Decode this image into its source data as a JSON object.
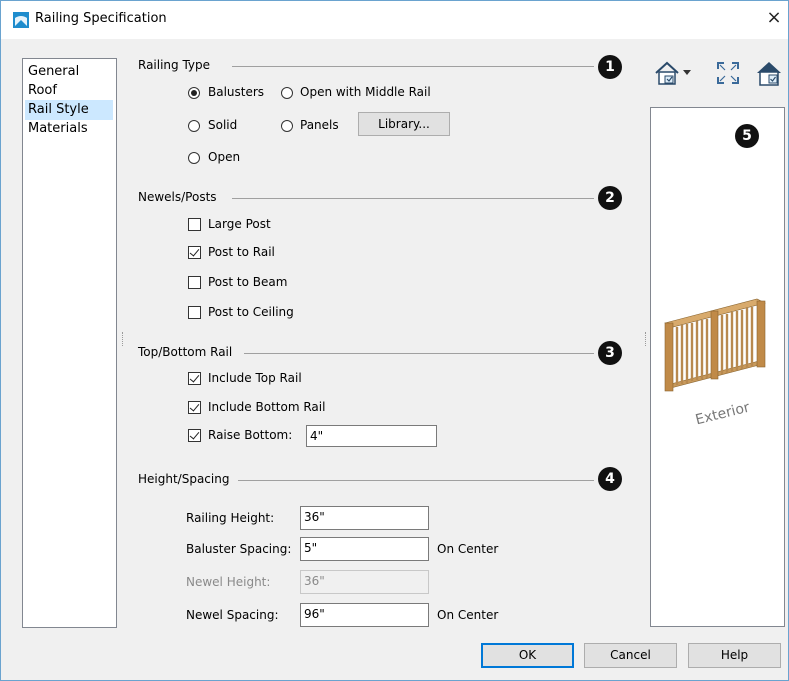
{
  "window": {
    "title": "Railing Specification",
    "close_glyph": "×"
  },
  "nav": {
    "items": [
      "General",
      "Roof",
      "Rail Style",
      "Materials"
    ],
    "selected": "Rail Style"
  },
  "railing_type": {
    "title": "Railing Type",
    "badge": "1",
    "options": {
      "balusters": {
        "label": "Balusters",
        "selected": true
      },
      "open_middle_rail": {
        "label": "Open with Middle Rail",
        "selected": false
      },
      "solid": {
        "label": "Solid",
        "selected": false
      },
      "panels": {
        "label": "Panels",
        "selected": false
      },
      "open": {
        "label": "Open",
        "selected": false
      }
    },
    "library_button": "Library..."
  },
  "newels": {
    "title": "Newels/Posts",
    "badge": "2",
    "large_post": {
      "label": "Large Post",
      "checked": false
    },
    "post_to_rail": {
      "label": "Post to Rail",
      "checked": true
    },
    "post_to_beam": {
      "label": "Post to Beam",
      "checked": false
    },
    "post_to_ceiling": {
      "label": "Post to Ceiling",
      "checked": false
    }
  },
  "top_bottom_rail": {
    "title": "Top/Bottom Rail",
    "badge": "3",
    "include_top": {
      "label": "Include Top Rail",
      "checked": true
    },
    "include_bottom": {
      "label": "Include Bottom Rail",
      "checked": true
    },
    "raise_bottom": {
      "label": "Raise Bottom:",
      "checked": true,
      "value": "4\""
    }
  },
  "height_spacing": {
    "title": "Height/Spacing",
    "badge": "4",
    "railing_height": {
      "label": "Railing Height:",
      "value": "36\""
    },
    "baluster_spacing": {
      "label": "Baluster Spacing:",
      "value": "5\"",
      "suffix": "On Center"
    },
    "newel_height": {
      "label": "Newel Height:",
      "value": "36\"",
      "disabled": true
    },
    "newel_spacing": {
      "label": "Newel Spacing:",
      "value": "96\"",
      "suffix": "On Center"
    }
  },
  "preview": {
    "badge": "5",
    "label": "Exterior"
  },
  "toolbar": {
    "icons": [
      "view-mode-icon",
      "dropdown-arrow-icon",
      "fit-view-icon",
      "view-options-icon"
    ]
  },
  "buttons": {
    "ok": "OK",
    "cancel": "Cancel",
    "help": "Help"
  },
  "colors": {
    "accent": "#0078d7",
    "selection": "#cce8ff",
    "wood": "#c89a5c"
  }
}
